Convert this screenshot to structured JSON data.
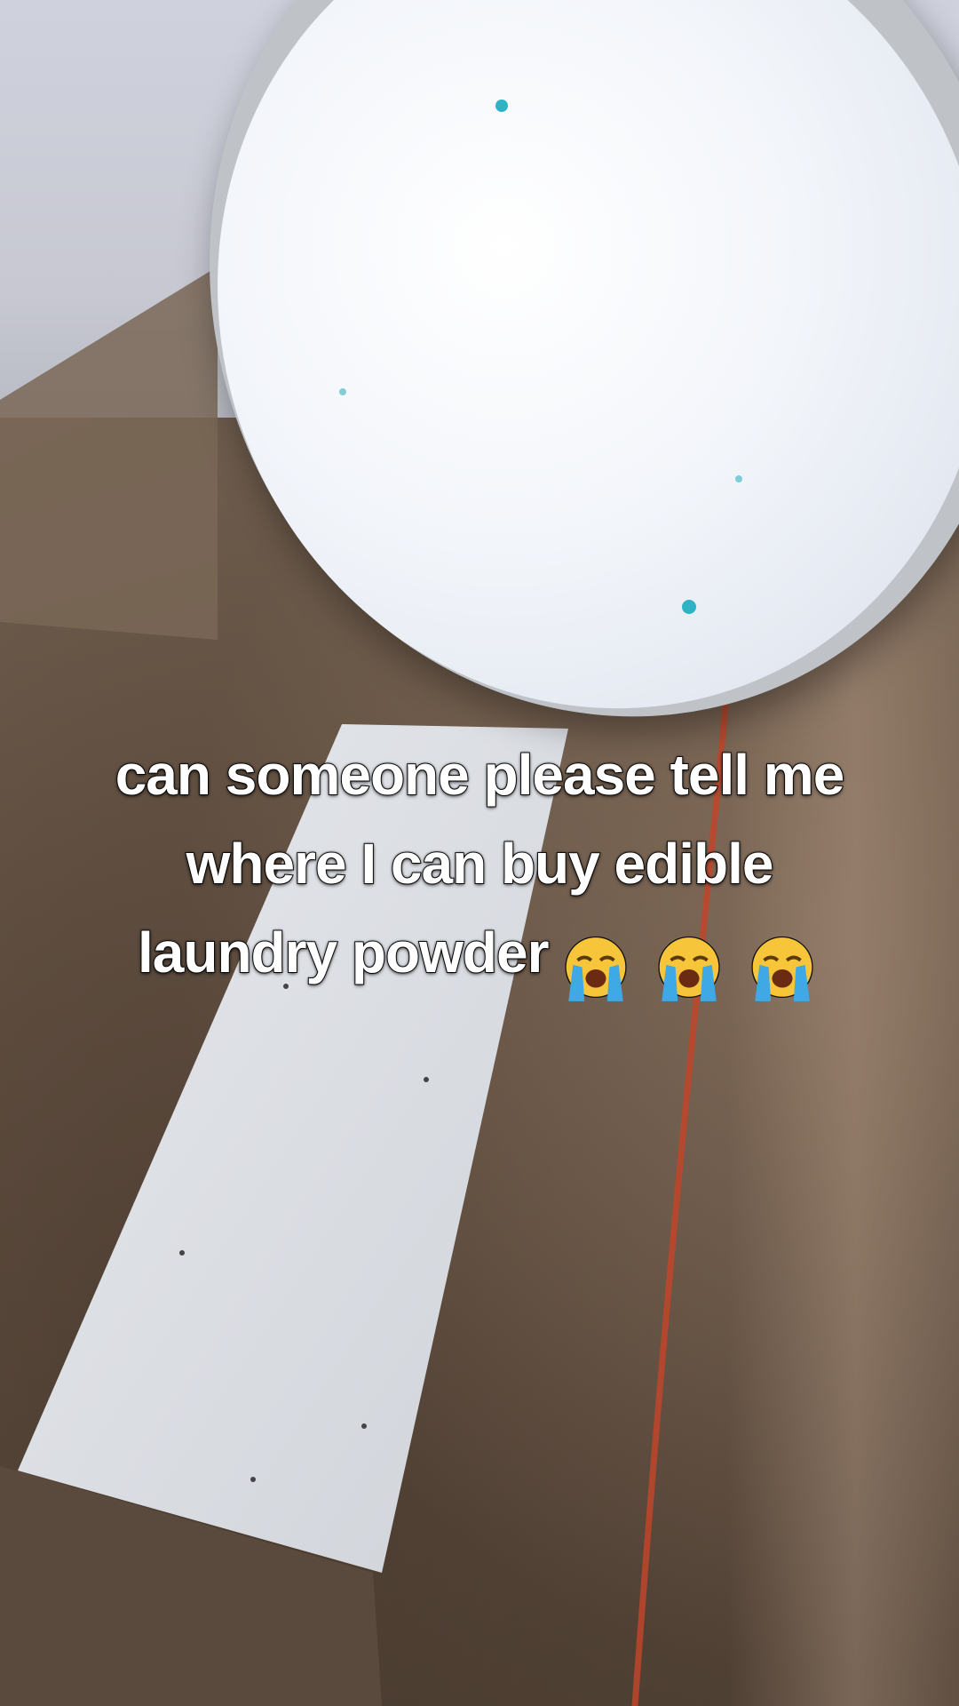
{
  "caption": {
    "line1": "can someone please tell me",
    "line2": "where I can buy edible",
    "line3_text": "laundry powder",
    "emojis": [
      "loudly-crying-face-icon",
      "loudly-crying-face-icon",
      "loudly-crying-face-icon"
    ]
  },
  "colors": {
    "caption_text": "#ffffff",
    "caption_outline": "#111111",
    "powder": "#f2f5fa",
    "powder_speck": "#2fb3c4",
    "cardboard": "#6d5b4b",
    "tape_line": "#c0452a"
  }
}
